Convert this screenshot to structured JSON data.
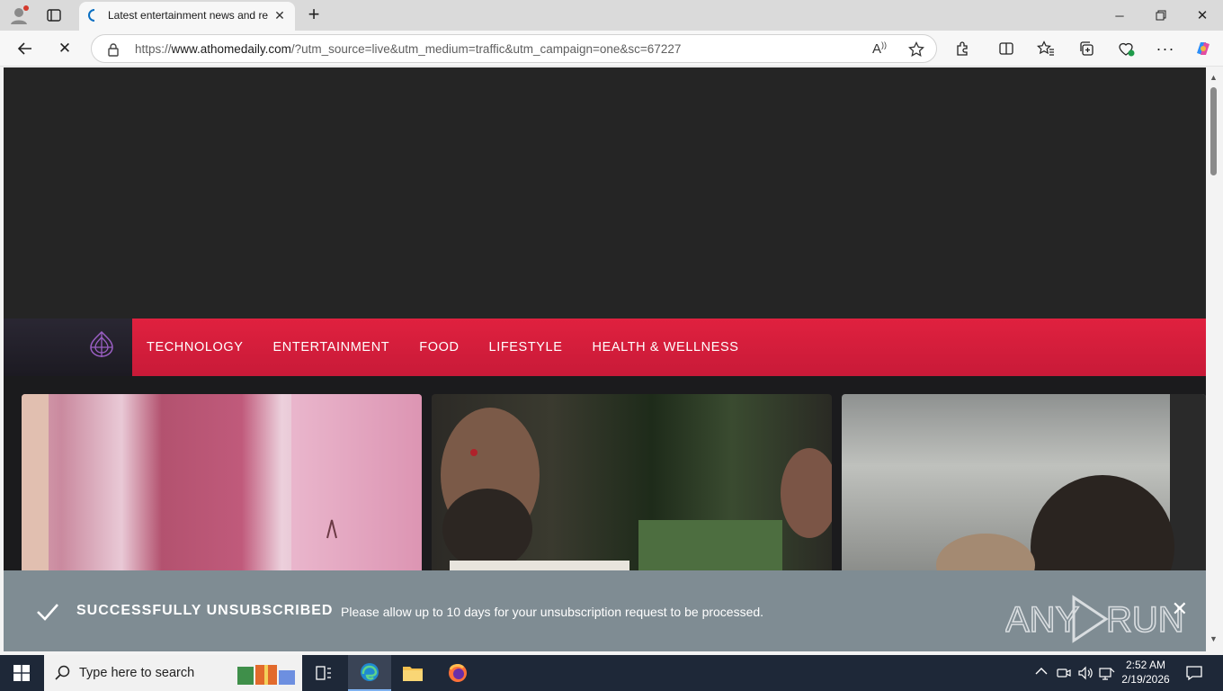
{
  "browser": {
    "tab": {
      "title": "Latest entertainment news and re"
    },
    "address": {
      "url_prefix": "https://",
      "url_domain": "www.athomedaily.com",
      "url_rest": "/?utm_source=live&utm_medium=traffic&utm_campaign=one&sc=67227"
    }
  },
  "site": {
    "nav_items": [
      "TECHNOLOGY",
      "ENTERTAINMENT",
      "FOOD",
      "LIFESTYLE",
      "HEALTH & WELLNESS"
    ]
  },
  "notice": {
    "title": "SUCCESSFULLY UNSUBSCRIBED",
    "message": "Please allow up to 10 days for your unsubscription request to be processed.",
    "watermark": "ANY RUN"
  },
  "taskbar": {
    "search_placeholder": "Type here to search",
    "time": "2:52 AM",
    "date": "2/19/2026"
  },
  "colors": {
    "nav_red": "#d81e3d",
    "notice_bg": "#7f8c93",
    "taskbar_bg": "#1e2838"
  }
}
